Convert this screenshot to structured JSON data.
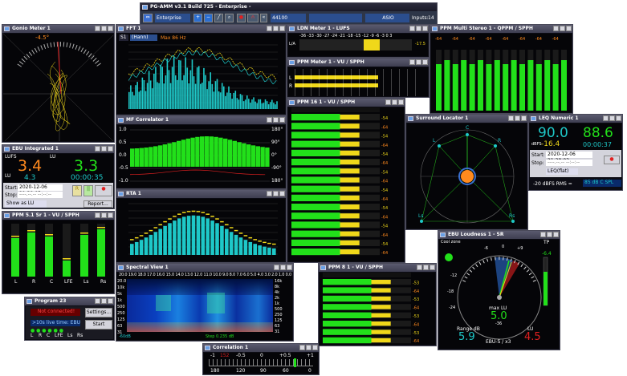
{
  "app": {
    "title": "PG-AMM v3.1 Build 725 - Enterprise -",
    "preset": "Enterprise",
    "samplerate": "44100",
    "driver": "ASIO",
    "inputs_label": "Inputs:",
    "inputs_value": "14"
  },
  "colors": {
    "green": "#22e01a",
    "yellow": "#f0d81a",
    "cyan": "#1ec8c8",
    "orange": "#ff8a1e",
    "red": "#e02020",
    "window": "#0c0c14"
  },
  "goniometer": {
    "title": "Gonio Meter 1",
    "angle": "-4.5°"
  },
  "ebu_integrated": {
    "title": "EBU Integrated 1",
    "lufs_label": "LUFS",
    "lu_label": "LU",
    "lufs_value": "3.4",
    "lu_value": "3.3",
    "range_value": "4.3",
    "time": "00:00:35",
    "start_label": "Start:",
    "start_value": "2020-12-06 21:38:05",
    "stop_label": "Stop:",
    "stop_value": "----.--.-- --:--:--",
    "show_as": "Show as LU",
    "report_btn": "Report..."
  },
  "ppm51": {
    "title": "PPM 5.1 Sr 1 - VU / SPPH",
    "channels": [
      "L",
      "R",
      "C",
      "LFE",
      "Ls",
      "Rs"
    ]
  },
  "program": {
    "title": "Program 23",
    "status": "Not connected!",
    "settings_btn": "Settings...",
    "info": ">10s live time: EBU",
    "start_btn": "Start",
    "channels": [
      "L",
      "R",
      "C",
      "LFE",
      "Ls",
      "Rs"
    ]
  },
  "fft": {
    "title": "FFT 1",
    "mode": "(Hann)",
    "max": "Max 86 Hz",
    "ch": "S1",
    "yticks": [
      "-10",
      "-20",
      "-30",
      "-40",
      "-50",
      "-60",
      "-70",
      "-80",
      "-90"
    ]
  },
  "correlator_mf": {
    "title": "MF Correlator 1",
    "yticks": [
      "1.0",
      "0.5",
      "0.0",
      "-0.5",
      "-1.0"
    ],
    "rticks": [
      "180°",
      "90°",
      "0°",
      "-90°",
      "180°"
    ]
  },
  "rta": {
    "title": "RTA 1",
    "yticks": [
      "-10",
      "-20",
      "-30",
      "-40",
      "-50",
      "-60",
      "-70",
      "-80",
      "-90"
    ]
  },
  "spectral": {
    "title": "Spectral View 1",
    "left_ticks": [
      "20.0",
      "10k",
      "5k",
      "1k",
      "500",
      "250",
      "125",
      "63",
      "31"
    ],
    "right_ticks": [
      "16k",
      "8k",
      "4k",
      "2k",
      "1k",
      "500",
      "250",
      "125",
      "63",
      "31"
    ],
    "axis": "20.0 19.0 18.0 17.0 16.0 15.0 14.0 13.0 12.0 11.0 10.0 9.0 8.0 7.0 6.0 5.0 4.0 3.0 2.0 1.0 0.0",
    "step": "Step 0.235 dB",
    "bottom_left": "-60dB"
  },
  "correlation": {
    "title": "Correlation 1",
    "ticks": [
      "-1",
      "-0.5",
      "0",
      "+0.5",
      "+1"
    ],
    "deg": [
      "180",
      "120",
      "90",
      "60",
      "0"
    ],
    "marker": "152"
  },
  "ldn": {
    "title": "LDN Meter 1 - LUFS",
    "scale": "-36 -33 -30 -27 -24 -21 -18 -15 -12 -9 -6 -3 0 3",
    "left": "L/A",
    "right": "-17.5"
  },
  "ppm_meter": {
    "title": "PPM Meter 1 - VU / SPPH",
    "left": "L",
    "right": "R"
  },
  "ppm16": {
    "title": "PPM 16 1 - VU / SPPH",
    "readings": [
      "-54",
      "-64",
      "-54",
      "-64",
      "-54",
      "-64",
      "-54",
      "-64",
      "-54",
      "-64",
      "-54",
      "-64",
      "-54",
      "-64",
      "-54",
      "-64"
    ]
  },
  "ppm81": {
    "title": "PPM 8 1 - VU / SPPH",
    "readings": [
      "-53",
      "-64",
      "-53",
      "-64",
      "-53",
      "-64",
      "-53",
      "-64"
    ]
  },
  "multistereo": {
    "title": "PPM Multi Stereo 1 - QPPM / SPPH",
    "peaks": [
      "-64",
      "-64",
      "-64",
      "-64",
      "-64",
      "-64",
      "-64",
      "-64"
    ]
  },
  "surround": {
    "title": "Surround Locator 1",
    "labels": [
      "C",
      "L",
      "R",
      "Ls",
      "Rs"
    ]
  },
  "leq": {
    "title": "LEQ Numeric 1",
    "left_value": "90.0",
    "right_value": "88.6",
    "unit": "dBFS",
    "offset": "-16.4",
    "time": "00:00:37",
    "start_label": "Start:",
    "start_value": "2020-12-06 21:38:03",
    "stop_label": "Stop:",
    "stop_value": "----.--.-- --:--:--",
    "weighting": "LEQ(flat)",
    "rms_label": "-20 dBFS RMS =",
    "rms_value": "85 dB C SPL"
  },
  "ebu_loudness": {
    "title": "EBU Loudness 1 - SR",
    "cool_label": "Cool zone",
    "tp_label": "TP",
    "tp_value": "-6.4",
    "max_label": "max LU",
    "max_value": "5.0",
    "range_label": "Range dB",
    "range_value": "5.9",
    "lu_label": "LU",
    "lu_value": "4.5",
    "scale": "EBU-S / x3",
    "ticks": [
      "+9",
      "+6",
      "+3",
      "0",
      "-3",
      "-6",
      "-9",
      "-12",
      "-14",
      "-18",
      "-20",
      "-24",
      "-26",
      "-36"
    ]
  }
}
